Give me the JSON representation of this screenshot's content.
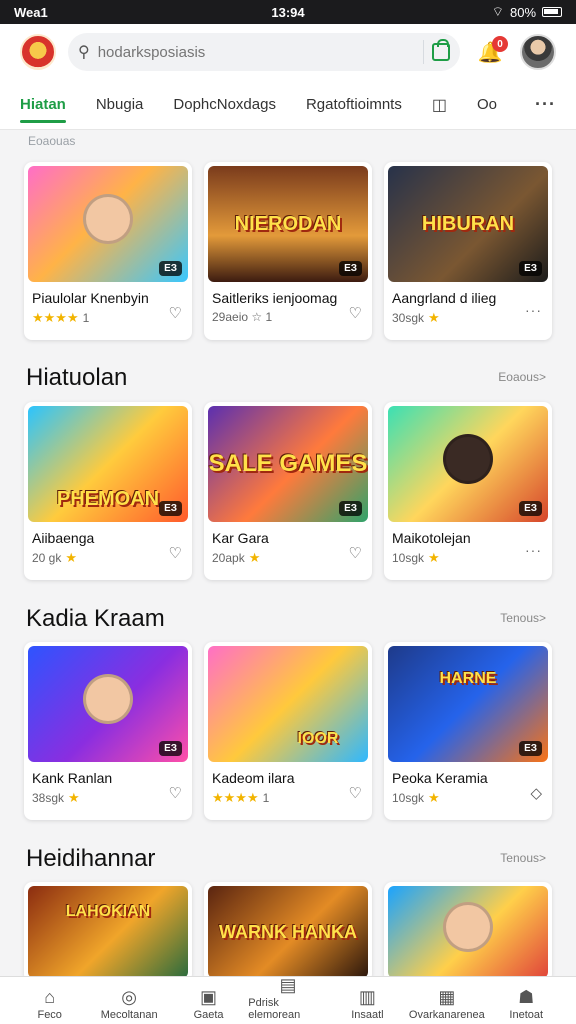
{
  "status": {
    "left": "Wea1",
    "center": "13:94",
    "right": "80%"
  },
  "header": {
    "search_placeholder": "hodarksposiasis",
    "notification_count": "0"
  },
  "tabs": [
    {
      "label": "Hiatan"
    },
    {
      "label": "Nbugia"
    },
    {
      "label": "DophcNoxdags"
    },
    {
      "label": "Rgatoftioimnts"
    },
    {
      "label": "Oo"
    }
  ],
  "subtle_label": "Eoaouas",
  "sections": [
    {
      "title": "",
      "more": "",
      "cards": [
        {
          "title": "Piaulolar Knenbyin",
          "meta": "1",
          "stars": "★★★★",
          "tag": "ЕЗ",
          "art": "",
          "action": "heart"
        },
        {
          "title": "Saitleriks ienjoomag",
          "meta": "29aeio  ☆ 1",
          "stars": "",
          "tag": "ЕЗ",
          "art": "NIERODAN",
          "action": "heart"
        },
        {
          "title": "Aangrland d ilieg",
          "meta": "30sgk",
          "stars": "★",
          "tag": "ЕЗ",
          "art": "HIBURAN",
          "action": "dots"
        }
      ]
    },
    {
      "title": "Hiatuolan",
      "more": "Eoaous>",
      "cards": [
        {
          "title": "Aiibaenga",
          "meta": "20 gk",
          "stars": "★",
          "tag": "ЕЗ",
          "art": "PHEMOAN",
          "action": "heart"
        },
        {
          "title": "Kar Gara",
          "meta": "20apk",
          "stars": "★",
          "tag": "ЕЗ",
          "art": "SALE GAMES",
          "action": "heart"
        },
        {
          "title": "Maikotolejan",
          "meta": "10sgk",
          "stars": "★",
          "tag": "ЕЗ",
          "art": "",
          "action": "dots"
        }
      ]
    },
    {
      "title": "Kadia Kraam",
      "more": "Tenous>",
      "cards": [
        {
          "title": "Kank Ranlan",
          "meta": "38sgk",
          "stars": "★",
          "tag": "ЕЗ",
          "art": "",
          "action": "heart"
        },
        {
          "title": "Kadeom ilara",
          "meta": "1",
          "stars": "★★★★",
          "tag": "",
          "art": "IOOR",
          "action": "heart"
        },
        {
          "title": "Peoka Keramia",
          "meta": "10sgk",
          "stars": "★",
          "tag": "ЕЗ",
          "art": "HARNE",
          "action": "dots"
        }
      ]
    },
    {
      "title": "Heidihannar",
      "more": "Tenous>",
      "cards": [
        {
          "title": "",
          "meta": "",
          "stars": "",
          "tag": "",
          "art": "LAHOKIAN",
          "action": ""
        },
        {
          "title": "",
          "meta": "",
          "stars": "",
          "tag": "",
          "art": "WARNK HANKA",
          "action": ""
        },
        {
          "title": "",
          "meta": "",
          "stars": "",
          "tag": "",
          "art": "",
          "action": ""
        }
      ]
    }
  ],
  "bottom_nav": [
    {
      "label": "Feco"
    },
    {
      "label": "Mecoltanan"
    },
    {
      "label": "Gaeta"
    },
    {
      "label": "Pdrisk elemorean"
    },
    {
      "label": "Insaatl"
    },
    {
      "label": "Ovarkanarenea"
    },
    {
      "label": "Inetoat"
    }
  ],
  "colors": {
    "accent": "#1e9d46",
    "badge": "#e53935",
    "star": "#f2b400"
  }
}
